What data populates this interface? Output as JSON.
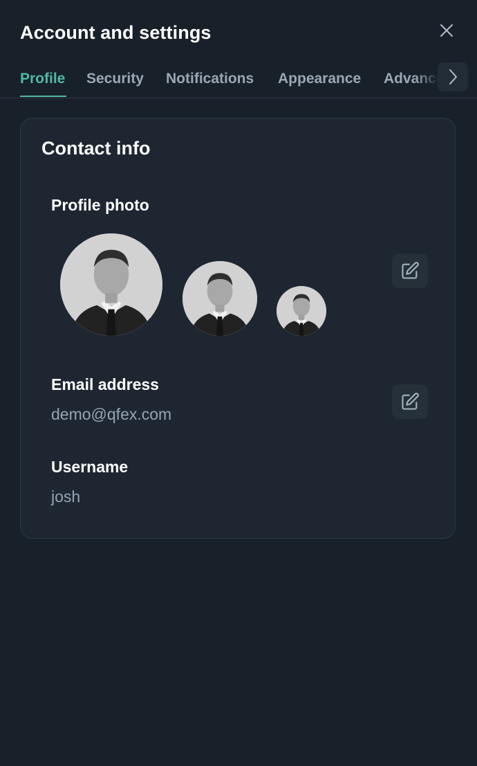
{
  "header": {
    "title": "Account and settings",
    "close_icon": "close-icon"
  },
  "tabs": [
    {
      "label": "Profile",
      "active": true
    },
    {
      "label": "Security",
      "active": false
    },
    {
      "label": "Notifications",
      "active": false
    },
    {
      "label": "Appearance",
      "active": false
    },
    {
      "label": "Advanced",
      "active": false
    }
  ],
  "tab_scroll_icon": "chevron-right-icon",
  "card": {
    "title": "Contact info",
    "profile_photo": {
      "label": "Profile photo",
      "sizes": [
        "large",
        "medium",
        "small"
      ],
      "edit_icon": "edit-icon"
    },
    "email": {
      "label": "Email address",
      "value": "demo@qfex.com",
      "edit_icon": "edit-icon"
    },
    "username": {
      "label": "Username",
      "value": "josh"
    }
  },
  "colors": {
    "background": "#18202a",
    "card_background": "#1d2631",
    "accent": "#4fb9a5",
    "muted_text": "#96a4b4",
    "tab_text": "#9aa7b5"
  }
}
